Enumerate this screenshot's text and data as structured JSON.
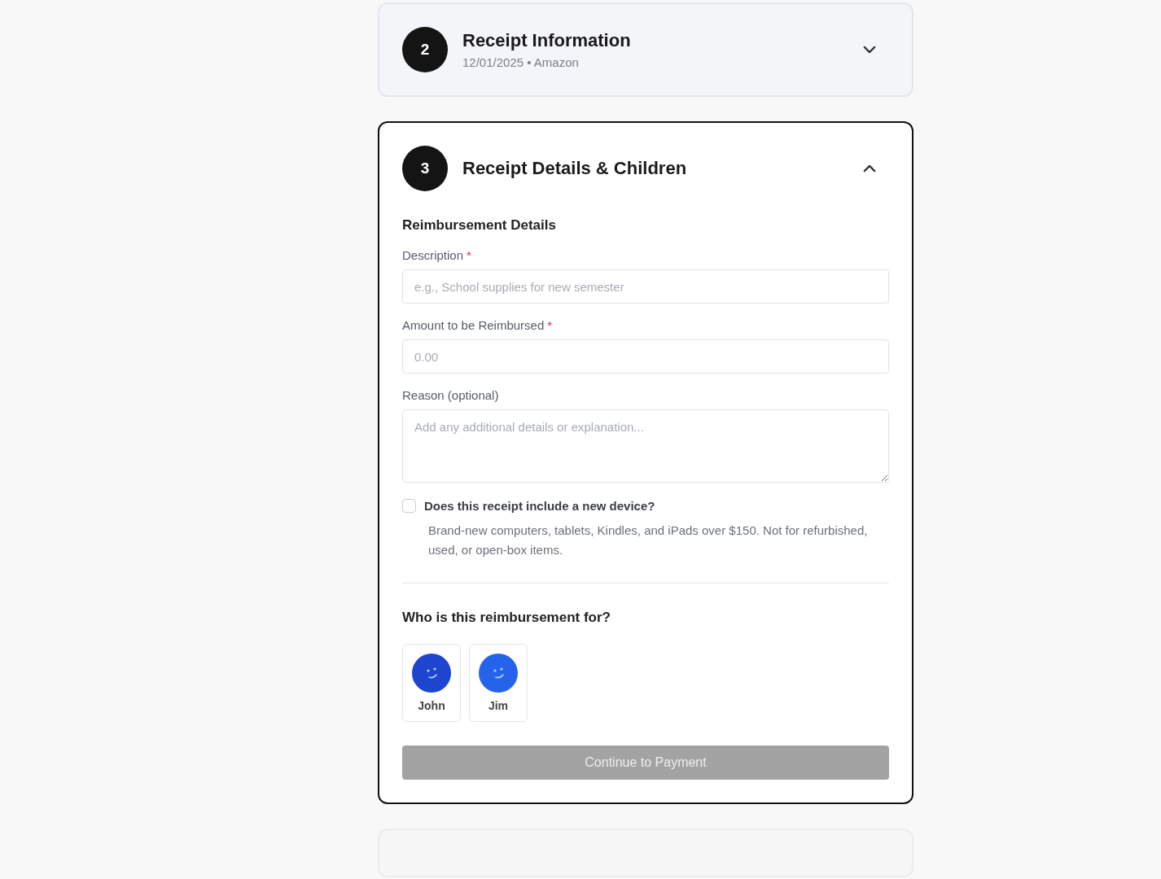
{
  "steps": [
    {
      "number": "2",
      "title": "Receipt Information",
      "subtitle": "12/01/2025 • Amazon",
      "expanded": false
    },
    {
      "number": "3",
      "title": "Receipt Details & Children",
      "expanded": true
    }
  ],
  "details": {
    "heading": "Reimbursement Details",
    "fields": [
      {
        "kind": "input",
        "label": "Description",
        "required": true,
        "placeholder": "e.g., School supplies for new semester"
      },
      {
        "kind": "input",
        "label": "Amount to be Reimbursed",
        "required": true,
        "placeholder": "0.00"
      },
      {
        "kind": "textarea",
        "label": "Reason (optional)",
        "required": false,
        "placeholder": "Add any additional details or explanation..."
      }
    ],
    "required_mark": "*",
    "device": {
      "label": "Does this receipt include a new device?",
      "checked": false,
      "help": "Brand-new computers, tablets, Kindles, and iPads over $150. Not for refurbished, used, or open-box items."
    }
  },
  "children": {
    "heading": "Who is this reimbursement for?",
    "items": [
      {
        "name": "John",
        "selected": false,
        "color": "#1d45d0"
      },
      {
        "name": "Jim",
        "selected": false,
        "color": "#2563eb"
      }
    ]
  },
  "continue_button": {
    "label": "Continue to Payment",
    "disabled": true
  }
}
